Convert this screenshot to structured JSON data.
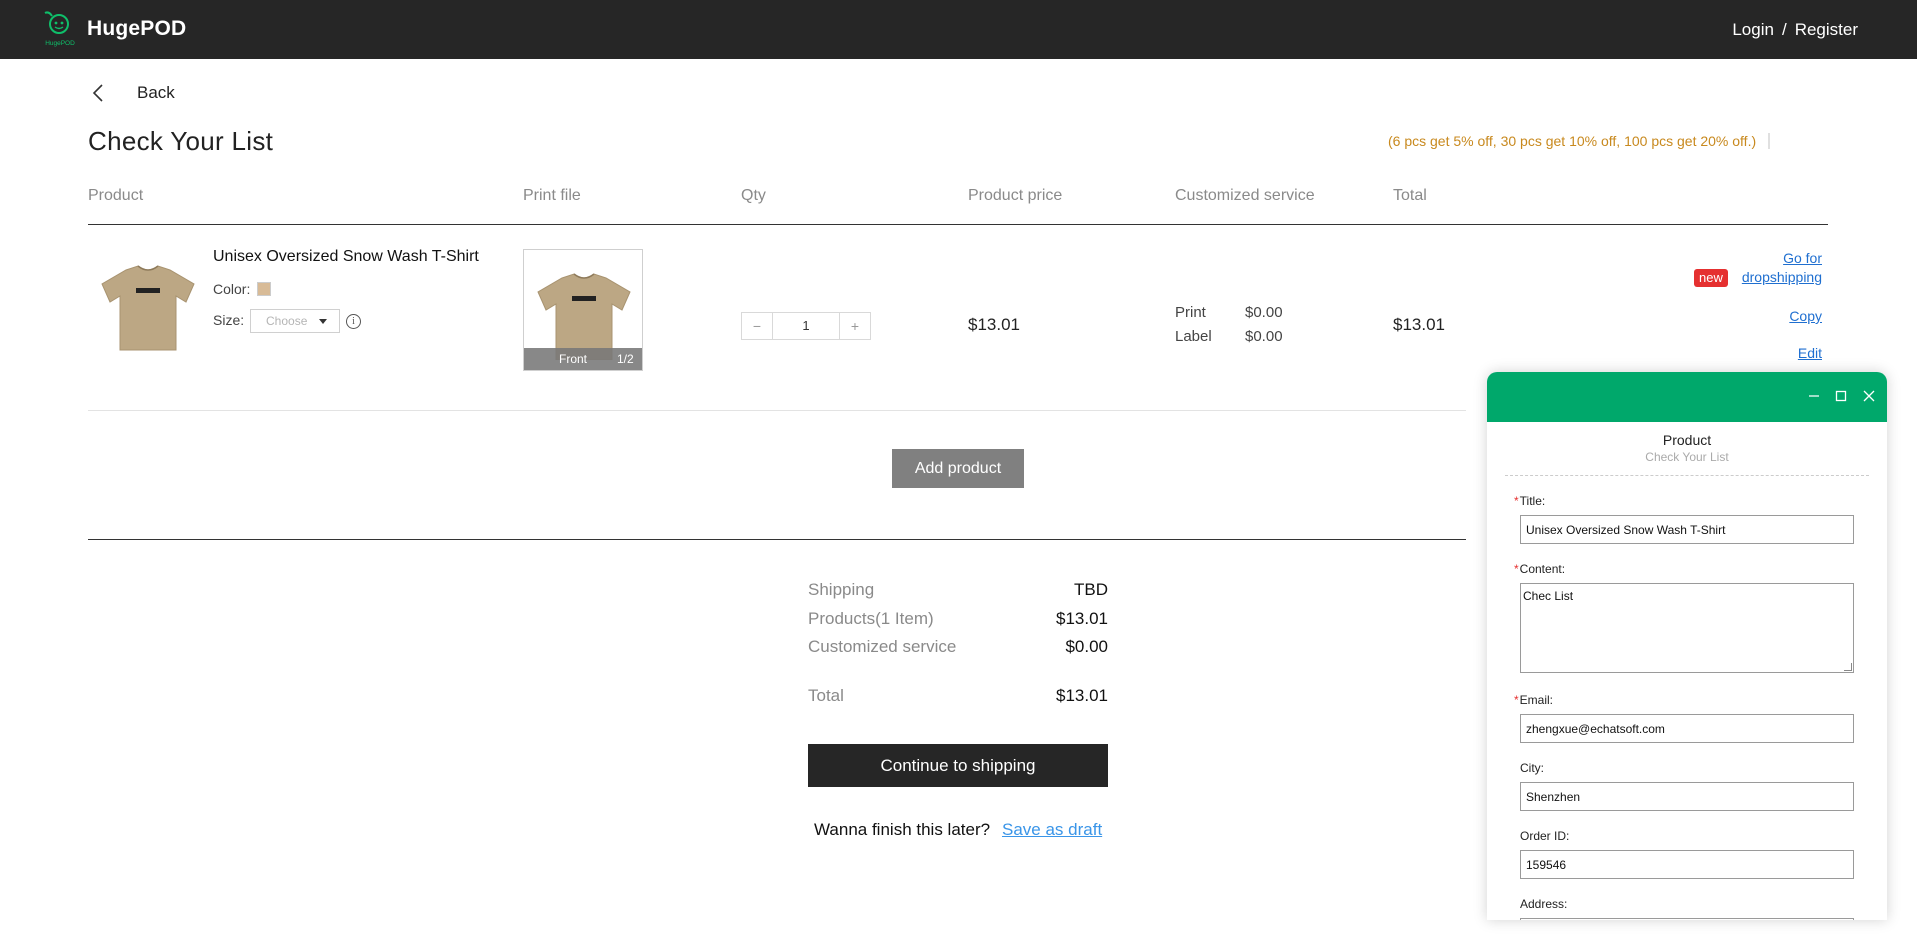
{
  "header": {
    "brand": "HugePOD",
    "logo_text": "HugePOD",
    "login": "Login",
    "separator": "/",
    "register": "Register"
  },
  "nav": {
    "back_label": "Back"
  },
  "page": {
    "title": "Check Your List",
    "discount_note": "(6 pcs get 5% off,  30 pcs get 10% off, 100 pcs get 20% off.)"
  },
  "table": {
    "headers": [
      "Product",
      "Print file",
      "Qty",
      "Product price",
      "Customized service",
      "Total"
    ]
  },
  "item": {
    "name": "Unisex Oversized Snow Wash T-Shirt",
    "color_label": "Color:",
    "color_hex": "#d8bb97",
    "size_label": "Size:",
    "size_placeholder": "Choose",
    "print_side": "Front",
    "print_page": "1/2",
    "quantity": "1",
    "qty_minus": "−",
    "qty_plus": "+",
    "price": "$13.01",
    "services": [
      {
        "label": "Print",
        "value": "$0.00"
      },
      {
        "label": "Label",
        "value": "$0.00"
      }
    ],
    "total": "$13.01",
    "actions": {
      "go_for": "Go for",
      "new_badge": "new",
      "dropshipping": "dropshipping",
      "copy": "Copy",
      "edit": "Edit"
    }
  },
  "add_product": "Add product",
  "summary": {
    "rows": [
      {
        "label": "Shipping",
        "value": "TBD"
      },
      {
        "label": "Products(1 Item)",
        "value": "$13.01"
      },
      {
        "label": "Customized service",
        "value": "$0.00"
      },
      {
        "label": "Total",
        "value": "$13.01"
      }
    ],
    "continue_button": "Continue to shipping",
    "later_text": "Wanna finish this later?",
    "save_draft": "Save as draft"
  },
  "panel": {
    "title": "Product",
    "subtitle": "Check Your List",
    "header_color": "#00a86b",
    "fields": {
      "title_label": "Title:",
      "title_value": "Unisex Oversized Snow Wash T-Shirt",
      "content_label": "Content:",
      "content_value": "Chec List",
      "email_label": "Email:",
      "email_value": "zhengxue@echatsoft.com",
      "city_label": "City:",
      "city_value": "Shenzhen",
      "order_label": "Order ID:",
      "order_value": "159546",
      "address_label": "Address:"
    },
    "required_mark": "*"
  },
  "colors": {
    "header_bg": "#262626",
    "accent_green": "#00a86b",
    "discount_text": "#c8891e",
    "link_blue": "#1f6fd0",
    "badge_red": "#e53030"
  }
}
